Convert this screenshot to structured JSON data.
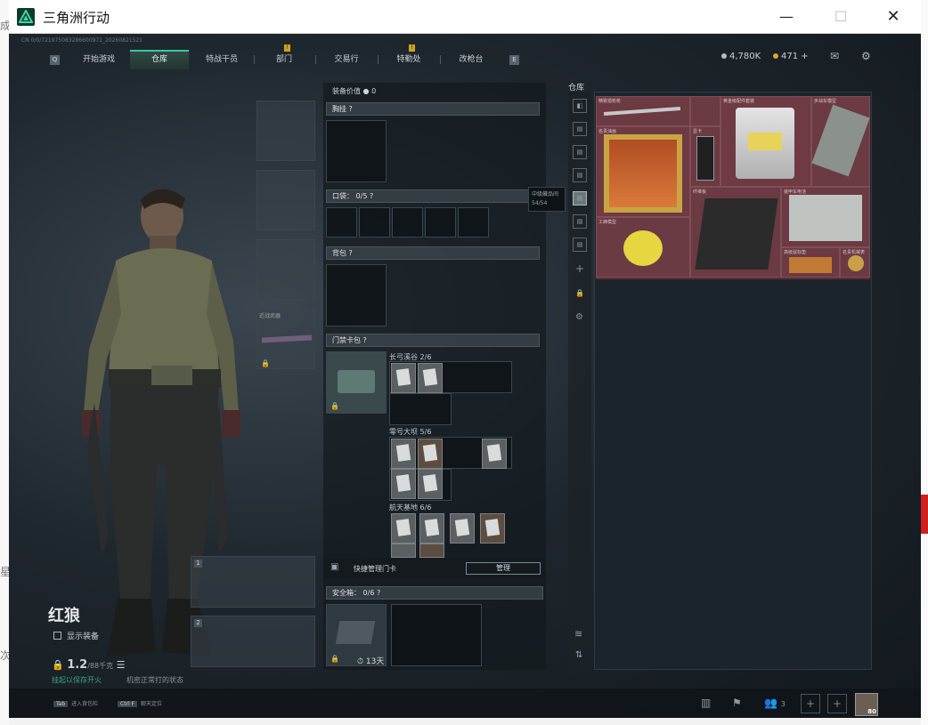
{
  "window": {
    "title": "三角洲行动",
    "minimize": "—",
    "maximize": "☐",
    "close": "✕"
  },
  "left_edge_texts": [
    "成",
    "星",
    "次"
  ],
  "uid": "CN 0/0/721975083286600971_20260821521",
  "nav": {
    "tabs": [
      "开始游戏",
      "仓库",
      "特战干员",
      "部门",
      "交易行",
      "特勤处",
      "改枪台"
    ],
    "active_tab": "仓库",
    "left_key": "Q",
    "right_key": "E",
    "notice_mark": "!"
  },
  "currency": {
    "silver": "4,780K",
    "gold": "471",
    "add": "+"
  },
  "character": {
    "name": "红狼",
    "show_equip_label": "显示装备",
    "weight_value": "1.2",
    "weight_max": "/88千克",
    "hint_green": "挂起以保存开火",
    "hint_gray": "机密正常打的状态"
  },
  "slots": {
    "melee_label": "近战武器",
    "gun1_badge": "1",
    "gun2_badge": "2"
  },
  "equipment": {
    "value_label": "装备价值",
    "value": "0",
    "chest_rig_label": "胸挂",
    "pocket_label": "口袋：",
    "pocket_count": "0/5",
    "backpack_label": "背包",
    "keycard_label": "门禁卡包",
    "keycard_rows": [
      {
        "label": "长弓溪谷 2/6"
      },
      {
        "label": "零号大坝 5/6"
      },
      {
        "label": "航天基地 6/6"
      }
    ],
    "quick_manage_label": "快捷管理门卡",
    "manage_button": "管理",
    "safe_box_label": "安全箱：",
    "safe_box_count": "0/6",
    "safe_box_days": "13天"
  },
  "warehouse": {
    "title": "仓库",
    "tooltip_title": "中级藏品间",
    "tooltip_count": "54/54",
    "items": [
      "精致猎枪枪",
      "黄金级配件套装",
      "步战车模型",
      "名贵油画",
      "显卡",
      "纤维板",
      "装甲车电池",
      "工蜂模型",
      "高级鼠标垫",
      "名贵机械表"
    ]
  },
  "bottom_bar": {
    "tab_key": "Tab",
    "tab_hint": "进入背包栏",
    "ctrl_key": "Ctrl F",
    "ctrl_hint": "聊天定位",
    "friends": "3",
    "avatar_level": "80"
  }
}
